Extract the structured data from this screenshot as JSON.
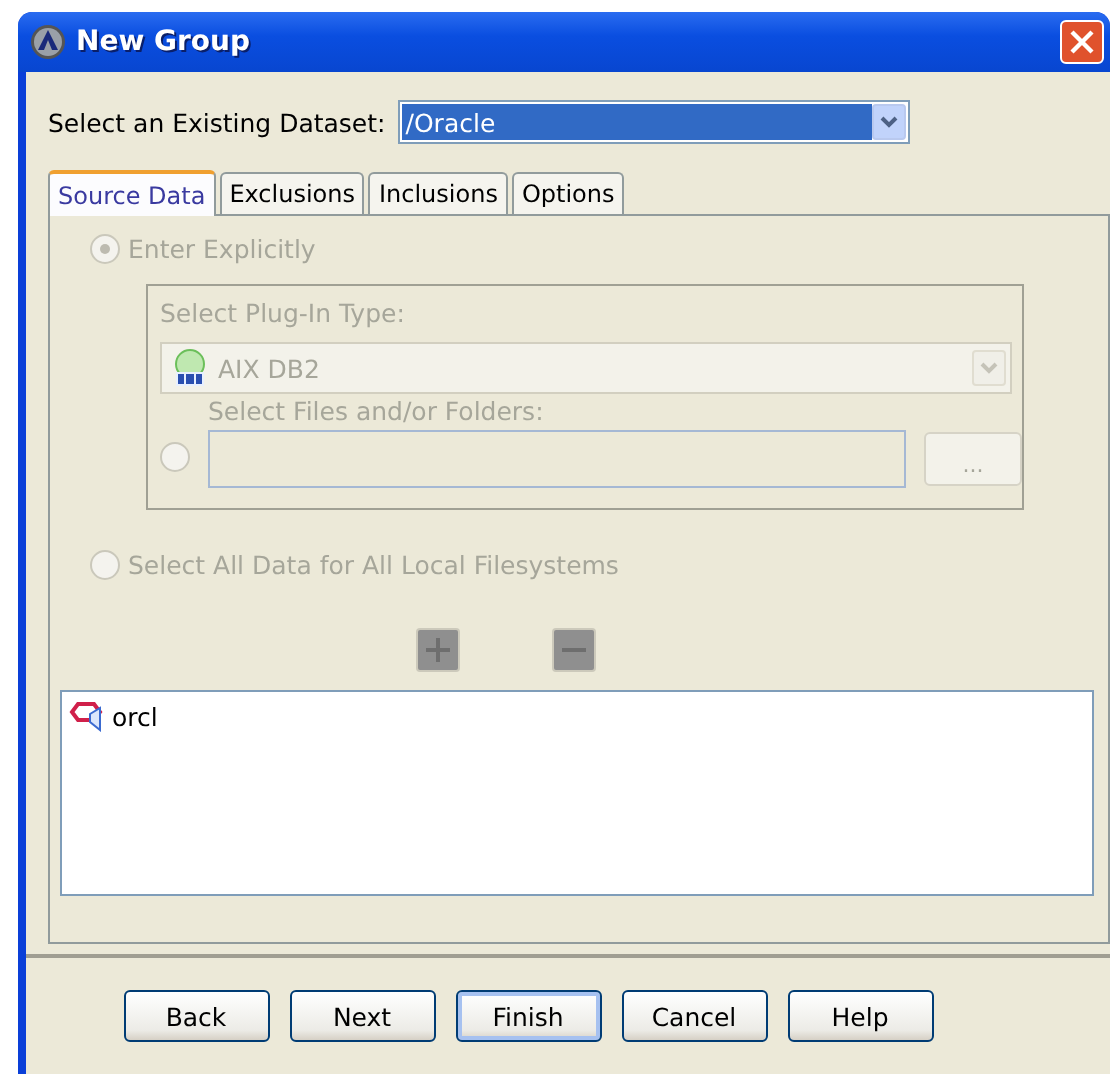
{
  "window": {
    "title": "New Group"
  },
  "dataset": {
    "label": "Select an Existing Dataset:",
    "value": "/Oracle"
  },
  "tabs": [
    {
      "label": "Source Data",
      "selected": true
    },
    {
      "label": "Exclusions",
      "selected": false
    },
    {
      "label": "Inclusions",
      "selected": false
    },
    {
      "label": "Options",
      "selected": false
    }
  ],
  "enter_explicitly": {
    "label": "Enter Explicitly",
    "checked": true,
    "disabled": true
  },
  "plugin": {
    "label": "Select Plug-In Type:",
    "value": "AIX DB2",
    "disabled": true
  },
  "files": {
    "label": "Select Files and/or Folders:",
    "checked": false,
    "disabled": true,
    "browse": "..."
  },
  "all_data": {
    "label": "Select All Data for All Local Filesystems",
    "checked": false,
    "disabled": true
  },
  "list_items": [
    {
      "label": "orcl"
    }
  ],
  "buttons": [
    {
      "label": "Back",
      "default": false
    },
    {
      "label": "Next",
      "default": false
    },
    {
      "label": "Finish",
      "default": true
    },
    {
      "label": "Cancel",
      "default": false
    },
    {
      "label": "Help",
      "default": false
    }
  ]
}
